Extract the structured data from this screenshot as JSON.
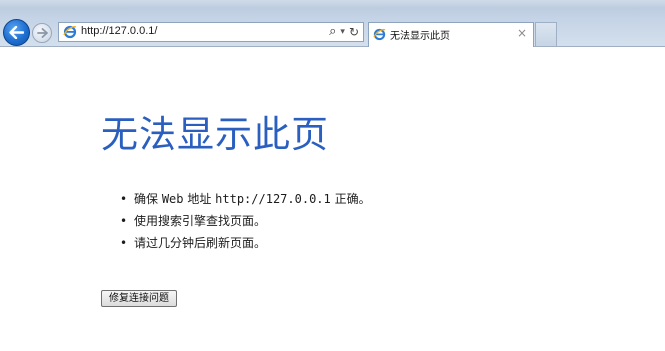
{
  "browser": {
    "address": "http://127.0.0.1/",
    "tab_title": "无法显示此页",
    "tab_close": "×",
    "search_glyph": "⌕",
    "dropdown_glyph": "▾",
    "refresh_glyph": "↻",
    "icons": {
      "back": "back-arrow-icon",
      "forward": "forward-arrow-icon",
      "page": "ie-icon",
      "search": "search-icon",
      "dropdown": "chevron-down-icon",
      "refresh": "refresh-icon"
    },
    "colors": {
      "back_button": "#1e6fd1",
      "chrome": "#c5d4e6"
    }
  },
  "page": {
    "title": "无法显示此页",
    "title_color": "#2a5fbf",
    "tips": [
      {
        "prefix": "确保 ",
        "mono": "Web",
        "middle": " 地址 ",
        "url": "http://127.0.0.1",
        "suffix": " 正确。"
      },
      {
        "text": "使用搜索引擎查找页面。"
      },
      {
        "text": "请过几分钟后刷新页面。"
      }
    ],
    "bullet": "•",
    "fix_button": "修复连接问题"
  }
}
